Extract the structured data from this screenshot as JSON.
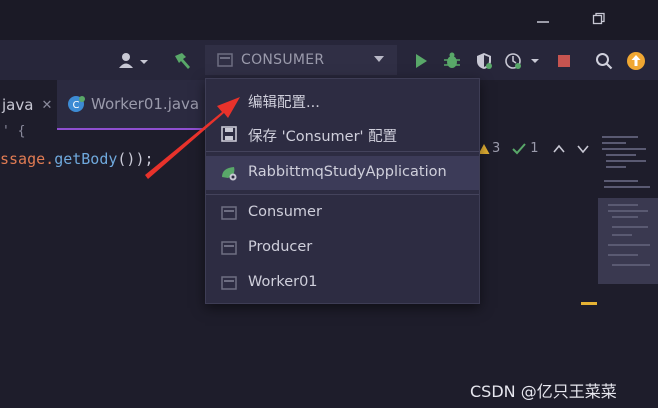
{
  "window": {
    "minimize_icon": "minimize-icon",
    "restore_icon": "restore-icon"
  },
  "toolbar": {
    "run_config": "CONSUMER",
    "icons": [
      "user-icon",
      "hammer-icon",
      "run-icon",
      "debug-icon",
      "coverage-icon",
      "profiler-icon",
      "stop-icon",
      "search-icon",
      "update-icon"
    ]
  },
  "tabs": [
    {
      "label": "java"
    },
    {
      "label": "Worker01.java"
    }
  ],
  "editor": {
    "code_fragment_1": "ssage.",
    "code_fragment_2": "getBody",
    "code_fragment_3": "());",
    "warnings_count": "3",
    "checks_count": "1"
  },
  "popup": {
    "edit_configs": "编辑配置...",
    "save_config": "保存 'Consumer' 配置",
    "items": [
      {
        "label": "RabbittmqStudyApplication"
      },
      {
        "label": "Consumer"
      },
      {
        "label": "Producer"
      },
      {
        "label": "Worker01"
      }
    ]
  },
  "colors": {
    "accent_green": "#59a869",
    "stop_red": "#c75450",
    "update_orange": "#f0a732",
    "selection": "#3c3b58"
  },
  "watermark": "CSDN @亿只王菜菜"
}
